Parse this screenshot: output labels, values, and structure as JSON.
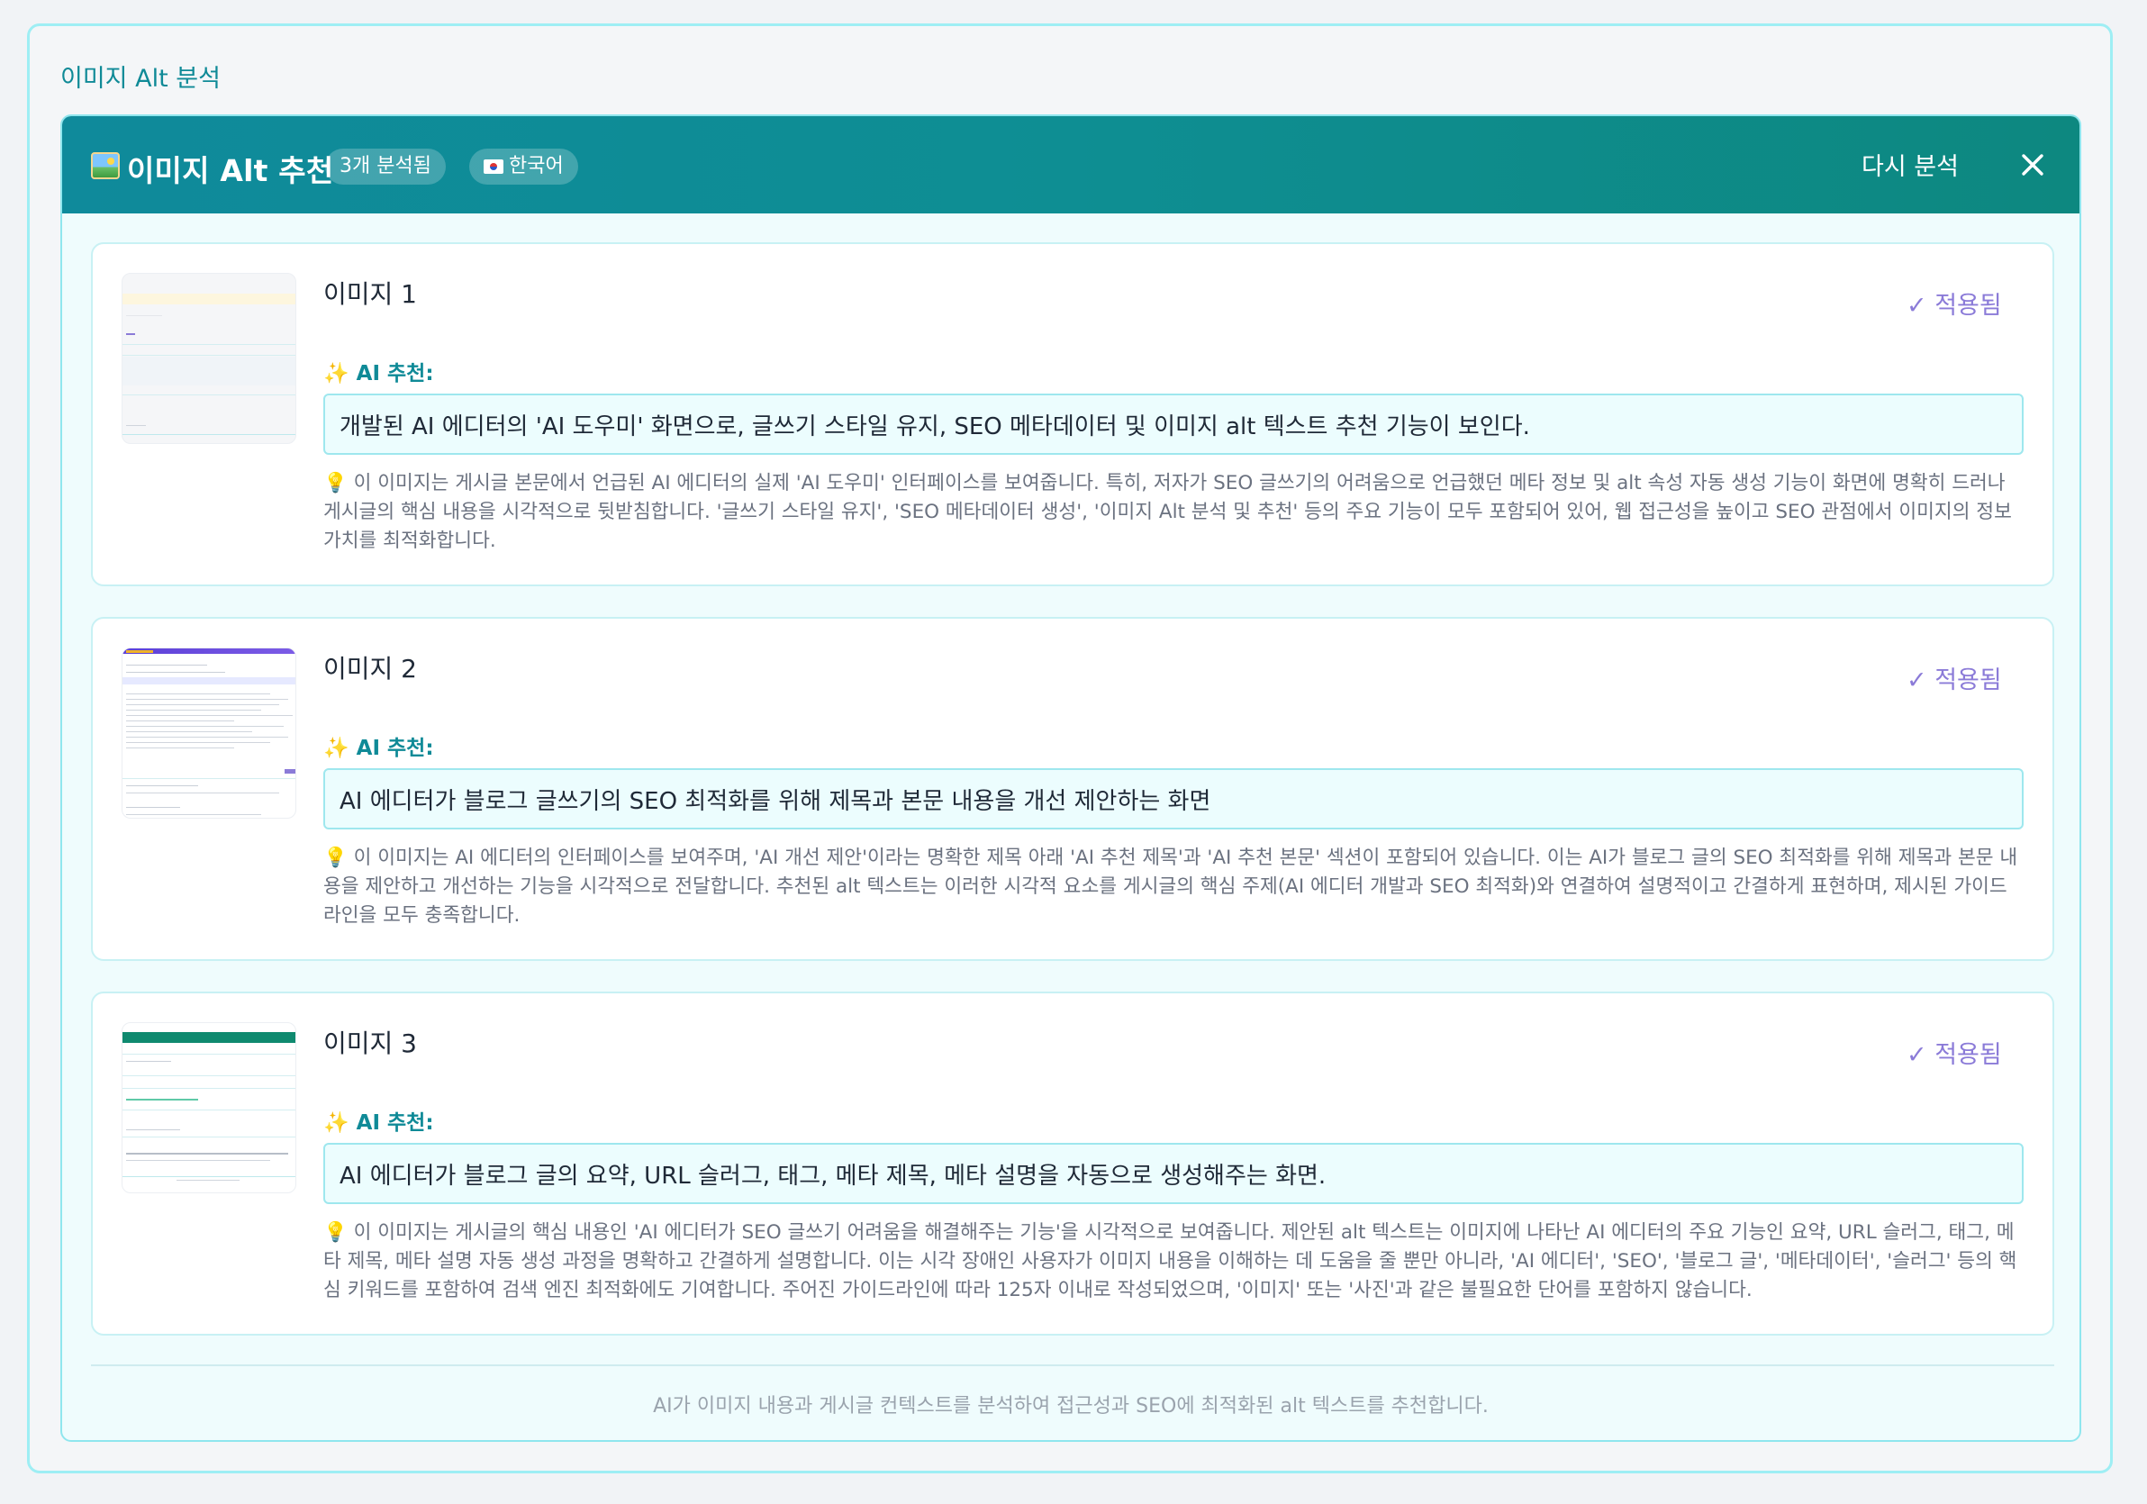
{
  "outer_title": "이미지 Alt 분석",
  "header": {
    "icon": "framed-picture-icon",
    "title": "이미지 Alt 추천",
    "count_badge": "3개 분석됨",
    "lang_flag": "kr-flag-icon",
    "lang_badge": "한국어",
    "reanalyze_label": "다시 분석",
    "close_icon": "close-icon"
  },
  "cards": [
    {
      "title": "이미지 1",
      "applied": "✓ 적용됨",
      "ai_label": "AI 추천:",
      "alt_value": "개발된 AI 에디터의 'AI 도우미' 화면으로, 글쓰기 스타일 유지, SEO 메타데이터 및 이미지 alt 텍스트 추천 기능이 보인다.",
      "reason": "이 이미지는 게시글 본문에서 언급된 AI 에디터의 실제 'AI 도우미' 인터페이스를 보여줍니다. 특히, 저자가 SEO 글쓰기의 어려움으로 언급했던 메타 정보 및 alt 속성 자동 생성 기능이 화면에 명확히 드러나 게시글의 핵심 내용을 시각적으로 뒷받침합니다. '글쓰기 스타일 유지', 'SEO 메타데이터 생성', '이미지 Alt 분석 및 추천' 등의 주요 기능이 모두 포함되어 있어, 웹 접근성을 높이고 SEO 관점에서 이미지의 정보 가치를 최적화합니다."
    },
    {
      "title": "이미지 2",
      "applied": "✓ 적용됨",
      "ai_label": "AI 추천:",
      "alt_value": "AI 에디터가 블로그 글쓰기의 SEO 최적화를 위해 제목과 본문 내용을 개선 제안하는 화면",
      "reason": "이 이미지는 AI 에디터의 인터페이스를 보여주며, 'AI 개선 제안'이라는 명확한 제목 아래 'AI 추천 제목'과 'AI 추천 본문' 섹션이 포함되어 있습니다. 이는 AI가 블로그 글의 SEO 최적화를 위해 제목과 본문 내용을 제안하고 개선하는 기능을 시각적으로 전달합니다. 추천된 alt 텍스트는 이러한 시각적 요소를 게시글의 핵심 주제(AI 에디터 개발과 SEO 최적화)와 연결하여 설명적이고 간결하게 표현하며, 제시된 가이드라인을 모두 충족합니다."
    },
    {
      "title": "이미지 3",
      "applied": "✓ 적용됨",
      "ai_label": "AI 추천:",
      "alt_value": "AI 에디터가 블로그 글의 요약, URL 슬러그, 태그, 메타 제목, 메타 설명을 자동으로 생성해주는 화면.",
      "reason": "이 이미지는 게시글의 핵심 내용인 'AI 에디터가 SEO 글쓰기 어려움을 해결해주는 기능'을 시각적으로 보여줍니다. 제안된 alt 텍스트는 이미지에 나타난 AI 에디터의 주요 기능인 요약, URL 슬러그, 태그, 메타 제목, 메타 설명 자동 생성 과정을 명확하고 간결하게 설명합니다. 이는 시각 장애인 사용자가 이미지 내용을 이해하는 데 도움을 줄 뿐만 아니라, 'AI 에디터', 'SEO', '블로그 글', '메타데이터', '슬러그' 등의 핵심 키워드를 포함하여 검색 엔진 최적화에도 기여합니다. 주어진 가이드라인에 따라 125자 이내로 작성되었으며, '이미지' 또는 '사진'과 같은 불필요한 단어를 포함하지 않습니다."
    }
  ],
  "footer": "AI가 이미지 내용과 게시글 컨텍스트를 분석하여 접근성과 SEO에 최적화된 alt 텍스트를 추천합니다."
}
